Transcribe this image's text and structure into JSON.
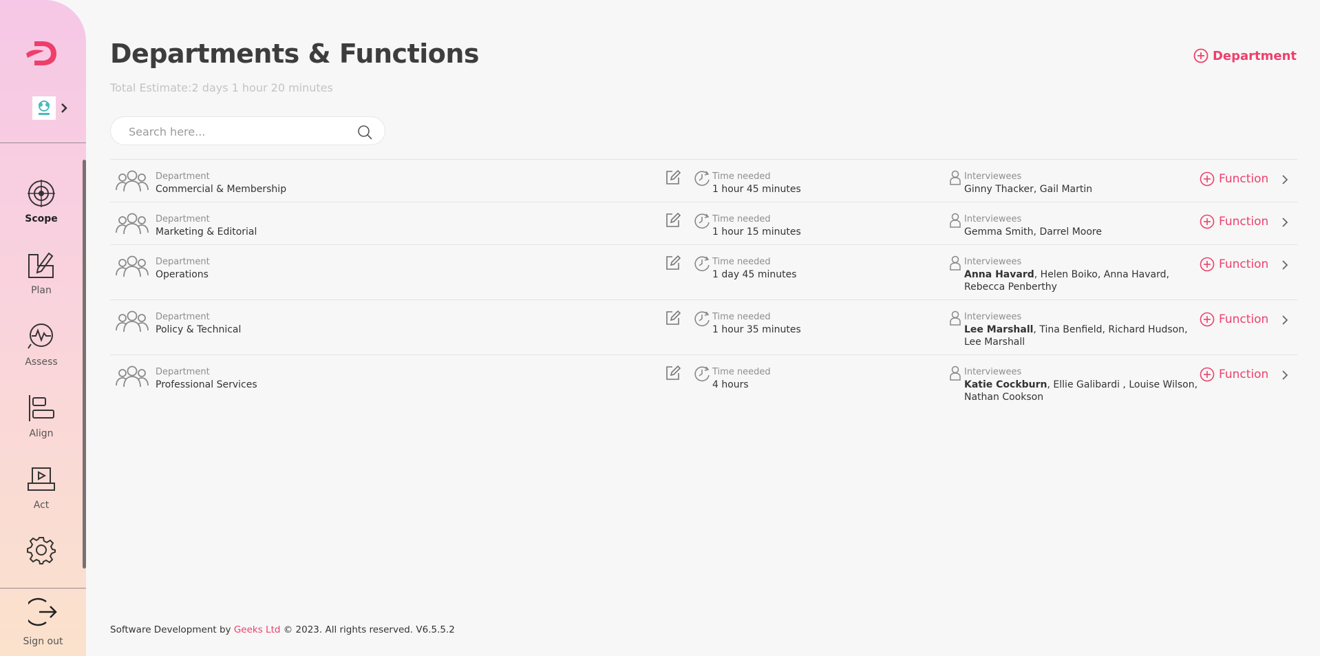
{
  "brand": {
    "accent": "#ee3f6b"
  },
  "sidebar": {
    "items": [
      {
        "label": "Scope",
        "icon": "target-icon",
        "active": true
      },
      {
        "label": "Plan",
        "icon": "plan-icon",
        "active": false
      },
      {
        "label": "Assess",
        "icon": "assess-icon",
        "active": false
      },
      {
        "label": "Align",
        "icon": "align-icon",
        "active": false
      },
      {
        "label": "Act",
        "icon": "act-icon",
        "active": false
      },
      {
        "label": "",
        "icon": "gear-icon",
        "active": false
      }
    ],
    "signout_label": "Sign out"
  },
  "header": {
    "title": "Departments & Functions",
    "estimate": "Total Estimate:2 days 1 hour 20 minutes",
    "add_department_label": "Department"
  },
  "search": {
    "placeholder": "Search here..."
  },
  "labels": {
    "department": "Department",
    "time_needed": "Time needed",
    "interviewees": "Interviewees",
    "function_button": "Function"
  },
  "departments": [
    {
      "name": "Commercial & Membership",
      "time": "1 hour 45 minutes",
      "lead": "",
      "interviewees_line1": "Ginny Thacker, Gail Martin",
      "interviewees_line2": ""
    },
    {
      "name": "Marketing & Editorial",
      "time": "1 hour 15 minutes",
      "lead": "",
      "interviewees_line1": "Gemma Smith, Darrel Moore",
      "interviewees_line2": ""
    },
    {
      "name": "Operations",
      "time": "1 day 45 minutes",
      "lead": "Anna Havard",
      "interviewees_line1": ", Helen Boiko, Anna Havard,",
      "interviewees_line2": "Rebecca Penberthy"
    },
    {
      "name": "Policy & Technical",
      "time": "1 hour 35 minutes",
      "lead": "Lee Marshall",
      "interviewees_line1": ", Tina Benfield, Richard Hudson,",
      "interviewees_line2": "Lee Marshall"
    },
    {
      "name": "Professional Services",
      "time": "4 hours",
      "lead": "Katie Cockburn",
      "interviewees_line1": ", Ellie Galibardi , Louise Wilson,",
      "interviewees_line2": "Nathan Cookson"
    }
  ],
  "footer": {
    "prefix": "Software Development by ",
    "company": "Geeks Ltd",
    "suffix": " © 2023. All rights reserved. V6.5.5.2"
  }
}
